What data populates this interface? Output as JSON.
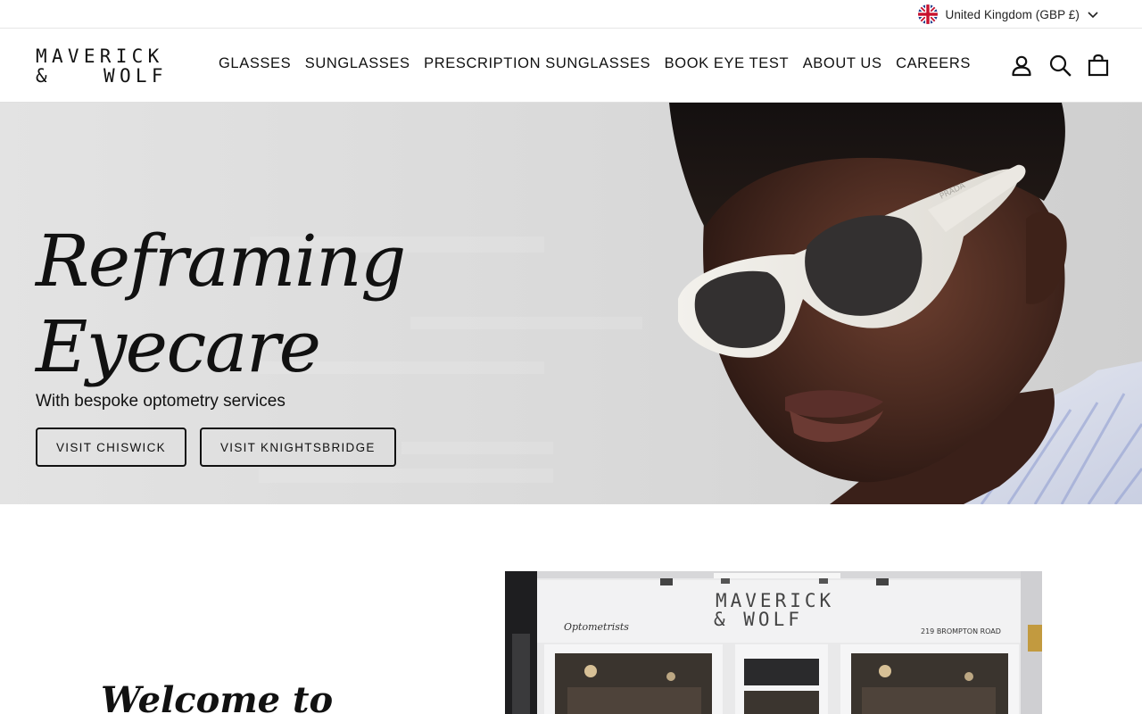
{
  "utility": {
    "currency_label": "United Kingdom (GBP £)",
    "flag_icon": "uk-flag-icon"
  },
  "header": {
    "logo_line1": "MAVERICK",
    "logo_amp": "&",
    "logo_line2": "WOLF",
    "nav": [
      {
        "label": "GLASSES"
      },
      {
        "label": "SUNGLASSES"
      },
      {
        "label": "PRESCRIPTION SUNGLASSES"
      },
      {
        "label": "BOOK EYE TEST"
      },
      {
        "label": "ABOUT US"
      },
      {
        "label": "CAREERS"
      }
    ],
    "icons": [
      "account-icon",
      "search-icon",
      "cart-icon"
    ]
  },
  "hero": {
    "title_line1": "Reframing",
    "title_line2": "Eyecare",
    "subtitle": "With bespoke optometry services",
    "buttons": [
      {
        "label": "VISIT CHISWICK"
      },
      {
        "label": "VISIT KNIGHTSBRIDGE"
      }
    ],
    "image": "model-with-white-sunglasses",
    "sunglasses_brand": "PRADA"
  },
  "welcome": {
    "title": "Welcome to"
  },
  "storefront": {
    "sign_line1": "MAVERICK",
    "sign_line2": "& WOLF",
    "sign_left": "Optometrists",
    "sign_right": "219 BROMPTON ROAD"
  },
  "colors": {
    "text": "#111111",
    "hero_bg": "#dcdcdc",
    "border": "#e0e0e0"
  }
}
